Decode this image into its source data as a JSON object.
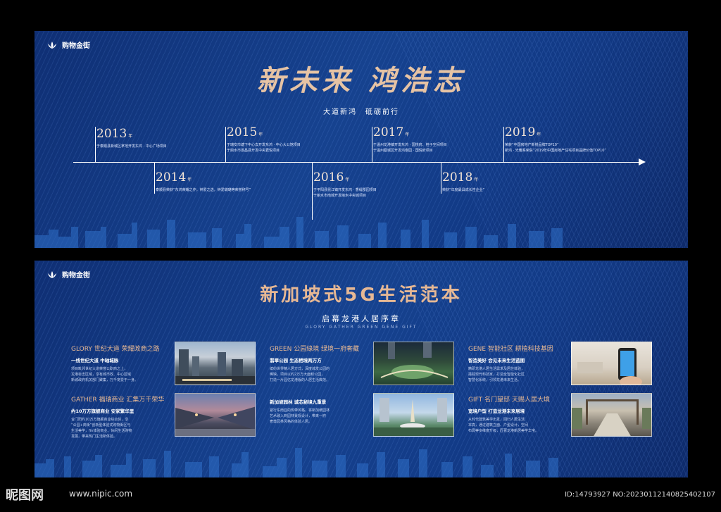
{
  "brand": {
    "logo_text": "购物金街"
  },
  "timeline": {
    "title": "新未来 鸿浩志",
    "subtitle": "大道新鸿　砥砺前行",
    "unit": "年",
    "events": [
      {
        "year": "2013",
        "lines": [
          "于泰顺县新城区拿地开发东鸿 · 中心广场项目"
        ]
      },
      {
        "year": "2014",
        "lines": [
          "泰顺县荣获“东鸿荣耀之作，钟爱之选，钟爱璐璐等荣誉称号”"
        ]
      },
      {
        "year": "2015",
        "lines": [
          "于瑞安市塘下中心去开发东鸿 · 中心大公馆项目",
          "于丽水市遂昌县开发中央君悦项目"
        ]
      },
      {
        "year": "2016",
        "lines": [
          "于平阳县昆江镇开发东鸿 · 香缇郡园项目",
          "于丽水市南城开发丽水中央城项目"
        ]
      },
      {
        "year": "2017",
        "lines": [
          "于温州龙港镇开发东鸿 · 国悦府、桂子空间项目",
          "于温州瓯城区开发鸿泰园 · 国悦府项目"
        ]
      },
      {
        "year": "2018",
        "lines": [
          "荣获“年度最具成长性企业”"
        ]
      },
      {
        "year": "2019",
        "lines": [
          "荣获“中国房地产新锐品牌TOP10”",
          "新鸿 · 光耀系荣获“2019年中国房地产住宅项目品牌价值TOP10”"
        ]
      }
    ]
  },
  "life": {
    "title": "新加坡式5G生活范本",
    "subtitle": "启幕龙港人居序章",
    "subtitle_en": "GLORY GATHER GREEN GENE GIFT",
    "blocks": [
      {
        "head": "GLORY 世纪大道 荣耀政商之路",
        "sub": "一线世纪大道 中轴城脉",
        "body": "项目毗邻世纪大道荣誉公职商之上，\n龙港标志区域，享有城市政、中心区域\n新城政府机关部门聚集，万千宠爱于一身。"
      },
      {
        "head": "GATHER 福瑞商业 汇集万千荣华",
        "sub": "约10万方旗舰商业 安家繁华里",
        "body": "合门阳约10万方旗舰商业综合体，享\n“公园+商街”创新型体验式购物街区与\n生活美学，fin体验商业、休闲生活购物\n发展，带来热门生活新体验。"
      },
      {
        "head": "GREEN 公园綠境 绿境一府奢藏",
        "sub": "翡翠公园 生态栖境两万方",
        "body": "缤纷世界精人居方式，深度城发公园的\n稀缺，项目以约2万方大面积公园，\n打造一片园亿龙港版的人居生活典范。"
      },
      {
        "head": "",
        "sub": "新加坡园林 城芯秘境九重景",
        "body": "紧行东南亚的热带风格，将新加坡园林\n艺术融入到园林景观设计，带来一府\n奢尊园林风格的体验人居。"
      },
      {
        "head": "GENE 智能社区 耕植科技基因",
        "sub": "智造美好 会见未来生活蓝图",
        "body": "精研龙港人居生活需求及居住体验，\n搭载现代科技家，打造全智能化社区\n智慧化系统，引领龙港未来生活。"
      },
      {
        "head": "GIFT 名门望邸 天赐人居大境",
        "sub": "宽境户型 打造龙港未来居境",
        "body": "从时代建筑美学出发，回归人居生活\n本真，通过建筑立面、户型设计，空间\n布局等多维度升级，匠著龙港新居美学华宅。"
      }
    ]
  },
  "footer": {
    "site_logo": "昵图网",
    "site_url": "www.nipic.com",
    "id_text": "ID:14793927 NO:20230112140825402107"
  }
}
